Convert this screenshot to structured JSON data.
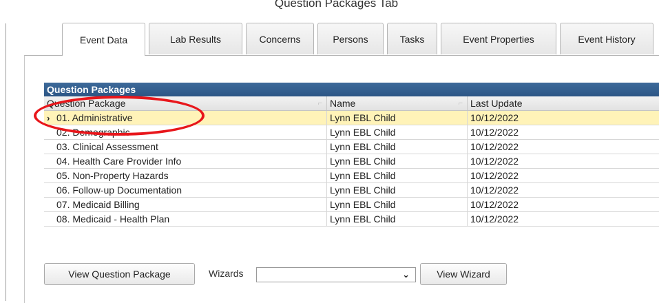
{
  "caption": "Question Packages Tab",
  "tabs": [
    {
      "label": "Event Data",
      "active": true
    },
    {
      "label": "Lab Results",
      "active": false
    },
    {
      "label": "Concerns",
      "active": false
    },
    {
      "label": "Persons",
      "active": false
    },
    {
      "label": "Tasks",
      "active": false
    },
    {
      "label": "Event Properties",
      "active": false
    },
    {
      "label": "Event History",
      "active": false
    }
  ],
  "grid": {
    "title": "Question Packages",
    "columns": [
      "Question Package",
      "Name",
      "Last Update"
    ],
    "selected_indicator": "›",
    "rows": [
      {
        "package": "01. Administrative",
        "name": "Lynn EBL Child",
        "updated": "10/12/2022",
        "selected": true
      },
      {
        "package": "02. Demographic",
        "name": "Lynn EBL Child",
        "updated": "10/12/2022",
        "selected": false
      },
      {
        "package": "03. Clinical Assessment",
        "name": "Lynn EBL Child",
        "updated": "10/12/2022",
        "selected": false
      },
      {
        "package": "04. Health Care Provider Info",
        "name": "Lynn EBL Child",
        "updated": "10/12/2022",
        "selected": false
      },
      {
        "package": "05. Non-Property Hazards",
        "name": "Lynn EBL Child",
        "updated": "10/12/2022",
        "selected": false
      },
      {
        "package": "06. Follow-up Documentation",
        "name": "Lynn EBL Child",
        "updated": "10/12/2022",
        "selected": false
      },
      {
        "package": "07. Medicaid Billing",
        "name": "Lynn EBL Child",
        "updated": "10/12/2022",
        "selected": false
      },
      {
        "package": "08. Medicaid - Health Plan",
        "name": "Lynn EBL Child",
        "updated": "10/12/2022",
        "selected": false
      }
    ]
  },
  "footer": {
    "view_package_label": "View Question Package",
    "wizards_label": "Wizards",
    "wizards_value": "",
    "view_wizard_label": "View Wizard"
  },
  "icons": {
    "dropdown": "chevron-down-icon",
    "row_indicator": "chevron-right-icon"
  },
  "colors": {
    "grid_title_bg": "#2c5585",
    "selected_row_bg": "#fff3b8",
    "annotation_circle": "#e8161b"
  }
}
